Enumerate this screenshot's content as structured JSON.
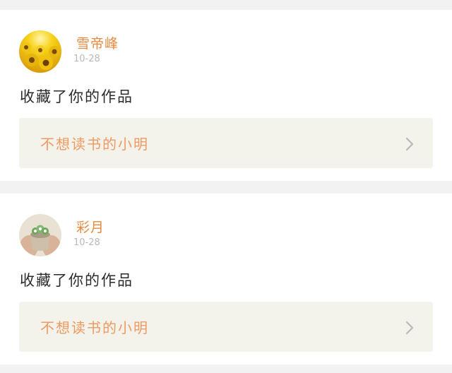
{
  "colors": {
    "background": "#f2f2f2",
    "card": "#ffffff",
    "username": "#e8893f",
    "date": "#b9b9b9",
    "action_text": "#2b2b2b",
    "work_box": "#f3f3ec",
    "work_title": "#ee9a60",
    "chevron": "#b8b8b8"
  },
  "notifications": [
    {
      "avatar": "sunflower-avatar",
      "username": "雪帝峰",
      "date": "10-28",
      "action": "收藏了你的作品",
      "work_title": "不想读书的小明",
      "chevron_icon": "chevron-right-icon"
    },
    {
      "avatar": "plant-pot-avatar",
      "username": "彩月",
      "date": "10-28",
      "action": "收藏了你的作品",
      "work_title": "不想读书的小明",
      "chevron_icon": "chevron-right-icon"
    }
  ]
}
